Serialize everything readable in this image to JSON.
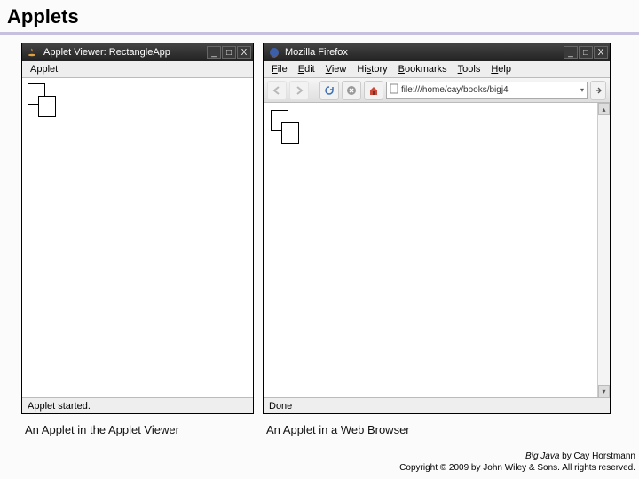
{
  "page": {
    "title": "Applets"
  },
  "left": {
    "windowTitle": "Applet Viewer: RectangleApp",
    "menu": {
      "applet": "Applet"
    },
    "status": "Applet started.",
    "caption": "An Applet in the Applet Viewer"
  },
  "right": {
    "windowTitle": "Mozilla Firefox",
    "menu": {
      "file": "File",
      "edit": "Edit",
      "view": "View",
      "history": "History",
      "bookmarks": "Bookmarks",
      "tools": "Tools",
      "help": "Help"
    },
    "address": "file:///home/cay/books/bigj4",
    "status": "Done",
    "caption": "An Applet in a Web Browser"
  },
  "credit": {
    "line1_bookTitle": "Big Java",
    "line1_rest": " by Cay Horstmann",
    "line2": "Copyright © 2009 by John Wiley & Sons.  All rights reserved."
  }
}
